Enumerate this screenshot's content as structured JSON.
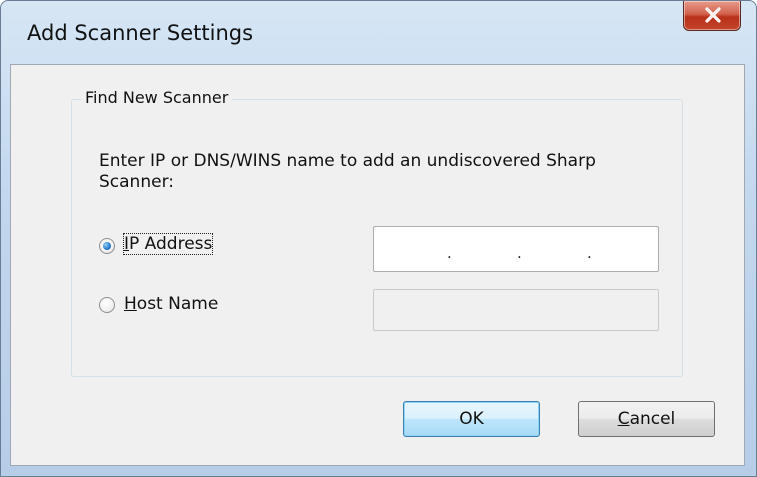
{
  "window": {
    "title": "Add Scanner Settings"
  },
  "groupbox": {
    "label": "Find New Scanner"
  },
  "prompt": {
    "text": "Enter IP or DNS/WINS name to add an undiscovered Sharp Scanner:"
  },
  "options": {
    "ip_address": {
      "mnemonic": "I",
      "rest": "P Address",
      "selected": true
    },
    "host_name": {
      "mnemonic": "H",
      "rest": "ost Name",
      "selected": false
    }
  },
  "fields": {
    "ip_address_value": ". . .",
    "host_name_value": ""
  },
  "buttons": {
    "ok_label": "OK",
    "cancel_mnemonic": "C",
    "cancel_rest": "ancel"
  },
  "icons": {
    "close": "close-x-icon",
    "radio_on": "radio-selected-icon",
    "radio_off": "radio-unselected-icon"
  },
  "colors": {
    "title_bar": "#c3d8ee",
    "close_button": "#c4442b",
    "client_bg": "#f0f0f0",
    "default_button": "#bee6fd"
  }
}
